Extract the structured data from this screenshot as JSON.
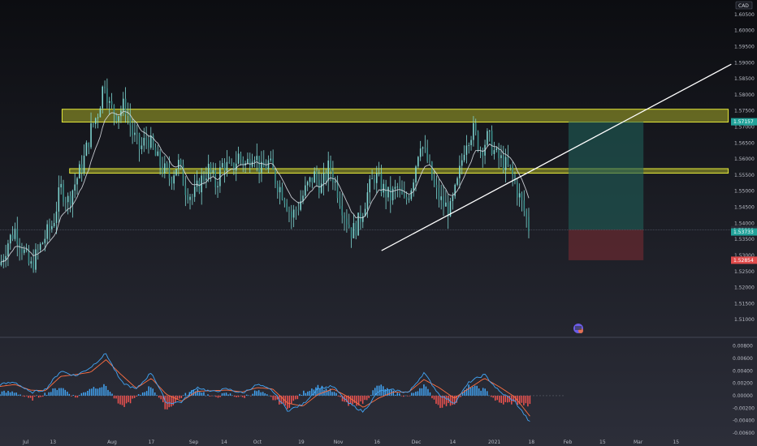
{
  "chart_data": [
    {
      "type": "candlestick",
      "currency": "CAD",
      "ylim": [
        1.5045,
        1.6095
      ],
      "y_ticks": [
        1.51,
        1.515,
        1.52,
        1.525,
        1.53,
        1.535,
        1.54,
        1.545,
        1.55,
        1.555,
        1.56,
        1.565,
        1.57,
        1.575,
        1.58,
        1.585,
        1.59,
        1.595,
        1.6,
        1.605
      ],
      "y_tick_labels": [
        "1.51000",
        "1.51500",
        "1.52000",
        "1.52500",
        "1.53000",
        "1.53500",
        "1.54000",
        "1.54500",
        "1.55000",
        "1.55500",
        "1.56000",
        "1.56500",
        "1.57000",
        "1.57500",
        "1.58000",
        "1.58500",
        "1.59000",
        "1.59500",
        "1.60000",
        "1.60500"
      ],
      "x_ticks": [
        {
          "label": "Jul",
          "x": 0.034
        },
        {
          "label": "13",
          "x": 0.07
        },
        {
          "label": "Aug",
          "x": 0.148
        },
        {
          "label": "17",
          "x": 0.2
        },
        {
          "label": "Sep",
          "x": 0.256
        },
        {
          "label": "14",
          "x": 0.296
        },
        {
          "label": "Oct",
          "x": 0.34
        },
        {
          "label": "19",
          "x": 0.398
        },
        {
          "label": "Nov",
          "x": 0.447
        },
        {
          "label": "16",
          "x": 0.498
        },
        {
          "label": "Dec",
          "x": 0.55
        },
        {
          "label": "14",
          "x": 0.598
        },
        {
          "label": "2021",
          "x": 0.653
        },
        {
          "label": "18",
          "x": 0.702
        },
        {
          "label": "Feb",
          "x": 0.75
        },
        {
          "label": "15",
          "x": 0.796
        },
        {
          "label": "Mar",
          "x": 0.843
        },
        {
          "label": "15",
          "x": 0.893
        }
      ],
      "price_path": [
        [
          0.0,
          1.527
        ],
        [
          0.01,
          1.534
        ],
        [
          0.02,
          1.538
        ],
        [
          0.03,
          1.532
        ],
        [
          0.04,
          1.526
        ],
        [
          0.05,
          1.531
        ],
        [
          0.06,
          1.536
        ],
        [
          0.07,
          1.54
        ],
        [
          0.08,
          1.551
        ],
        [
          0.09,
          1.547
        ],
        [
          0.1,
          1.553
        ],
        [
          0.11,
          1.559
        ],
        [
          0.12,
          1.569
        ],
        [
          0.13,
          1.575
        ],
        [
          0.138,
          1.585
        ],
        [
          0.145,
          1.576
        ],
        [
          0.155,
          1.574
        ],
        [
          0.165,
          1.577
        ],
        [
          0.175,
          1.568
        ],
        [
          0.185,
          1.563
        ],
        [
          0.195,
          1.567
        ],
        [
          0.205,
          1.561
        ],
        [
          0.215,
          1.557
        ],
        [
          0.225,
          1.554
        ],
        [
          0.235,
          1.559
        ],
        [
          0.245,
          1.551
        ],
        [
          0.255,
          1.548
        ],
        [
          0.265,
          1.553
        ],
        [
          0.275,
          1.557
        ],
        [
          0.285,
          1.552
        ],
        [
          0.295,
          1.559
        ],
        [
          0.305,
          1.556
        ],
        [
          0.315,
          1.561
        ],
        [
          0.325,
          1.558
        ],
        [
          0.335,
          1.563
        ],
        [
          0.345,
          1.556
        ],
        [
          0.355,
          1.559
        ],
        [
          0.365,
          1.553
        ],
        [
          0.375,
          1.549
        ],
        [
          0.385,
          1.542
        ],
        [
          0.395,
          1.546
        ],
        [
          0.405,
          1.551
        ],
        [
          0.415,
          1.555
        ],
        [
          0.425,
          1.551
        ],
        [
          0.435,
          1.558
        ],
        [
          0.445,
          1.551
        ],
        [
          0.455,
          1.543
        ],
        [
          0.465,
          1.537
        ],
        [
          0.475,
          1.541
        ],
        [
          0.485,
          1.549
        ],
        [
          0.495,
          1.555
        ],
        [
          0.505,
          1.551
        ],
        [
          0.515,
          1.548
        ],
        [
          0.525,
          1.551
        ],
        [
          0.535,
          1.546
        ],
        [
          0.545,
          1.553
        ],
        [
          0.555,
          1.566
        ],
        [
          0.565,
          1.559
        ],
        [
          0.575,
          1.55
        ],
        [
          0.585,
          1.546
        ],
        [
          0.595,
          1.544
        ],
        [
          0.605,
          1.553
        ],
        [
          0.615,
          1.566
        ],
        [
          0.625,
          1.569
        ],
        [
          0.635,
          1.563
        ],
        [
          0.645,
          1.567
        ],
        [
          0.655,
          1.561
        ],
        [
          0.665,
          1.559
        ],
        [
          0.675,
          1.556
        ],
        [
          0.685,
          1.549
        ],
        [
          0.695,
          1.542
        ],
        [
          0.7,
          1.5373
        ]
      ],
      "annotations": {
        "zones": [
          {
            "y_low": 1.5715,
            "y_high": 1.5755,
            "x0": 0.082,
            "x1": 0.962,
            "color": "#c8cc2c"
          },
          {
            "y_low": 1.5556,
            "y_high": 1.557,
            "x0": 0.092,
            "x1": 0.962,
            "color": "#c8cc2c"
          }
        ],
        "trendline": {
          "from": [
            0.504,
            1.5315
          ],
          "to": [
            0.966,
            1.5895
          ]
        },
        "position": {
          "x0": 0.751,
          "x1": 0.85,
          "entry": 1.538,
          "target": 1.5716,
          "stop": 1.5285
        }
      },
      "price_tags": [
        {
          "label": "1.57157",
          "y": 1.5716,
          "bg": "#22a39a",
          "fg": "#ffffff"
        },
        {
          "label": "1.53800",
          "y": 1.538,
          "bg": "#2a2d38",
          "fg": "#d1d4dc"
        },
        {
          "label": "1.53733",
          "y": 1.5373,
          "bg": "#22a39a",
          "fg": "#ffffff"
        },
        {
          "label": "1.52854",
          "y": 1.5285,
          "bg": "#e04b4b",
          "fg": "#ffffff"
        }
      ],
      "price_tag_extra": {
        "label": "1.5... ",
        "note": "partially hidden"
      }
    },
    {
      "type": "macd",
      "ylim": [
        -0.0068,
        0.0094
      ],
      "y_ticks": [
        0.008,
        0.006,
        0.004,
        0.002,
        0.0,
        -0.002,
        -0.004,
        -0.006
      ],
      "y_tick_labels": [
        "0.00800",
        "0.00600",
        "0.00400",
        "0.00200",
        "0.00000",
        "-0.00200",
        "-0.00400",
        "-0.00600"
      ],
      "macd_path": [
        [
          0.0,
          0.0018
        ],
        [
          0.02,
          0.0022
        ],
        [
          0.04,
          0.0005
        ],
        [
          0.06,
          0.001
        ],
        [
          0.08,
          0.004
        ],
        [
          0.1,
          0.0032
        ],
        [
          0.12,
          0.0046
        ],
        [
          0.14,
          0.0068
        ],
        [
          0.16,
          0.0022
        ],
        [
          0.18,
          0.001
        ],
        [
          0.2,
          0.0038
        ],
        [
          0.22,
          -0.0012
        ],
        [
          0.24,
          -0.001
        ],
        [
          0.26,
          0.0014
        ],
        [
          0.28,
          0.0006
        ],
        [
          0.3,
          0.0011
        ],
        [
          0.32,
          0.0004
        ],
        [
          0.34,
          0.0018
        ],
        [
          0.36,
          0.0008
        ],
        [
          0.38,
          -0.0024
        ],
        [
          0.4,
          -0.0014
        ],
        [
          0.42,
          0.0012
        ],
        [
          0.44,
          0.0015
        ],
        [
          0.46,
          -0.0012
        ],
        [
          0.48,
          -0.0026
        ],
        [
          0.5,
          0.0007
        ],
        [
          0.52,
          0.0009
        ],
        [
          0.54,
          0.0005
        ],
        [
          0.56,
          0.0037
        ],
        [
          0.58,
          0.0002
        ],
        [
          0.6,
          -0.0012
        ],
        [
          0.62,
          0.0022
        ],
        [
          0.64,
          0.0034
        ],
        [
          0.66,
          0.0006
        ],
        [
          0.68,
          -0.0009
        ],
        [
          0.7,
          -0.0043
        ]
      ],
      "signal_path": [
        [
          0.0,
          0.0015
        ],
        [
          0.02,
          0.0018
        ],
        [
          0.04,
          0.0009
        ],
        [
          0.06,
          0.0008
        ],
        [
          0.08,
          0.0031
        ],
        [
          0.1,
          0.0034
        ],
        [
          0.12,
          0.0038
        ],
        [
          0.14,
          0.0058
        ],
        [
          0.16,
          0.0034
        ],
        [
          0.18,
          0.0012
        ],
        [
          0.2,
          0.0028
        ],
        [
          0.22,
          0.0002
        ],
        [
          0.24,
          -0.0009
        ],
        [
          0.26,
          0.0007
        ],
        [
          0.28,
          0.0008
        ],
        [
          0.3,
          0.0009
        ],
        [
          0.32,
          0.0006
        ],
        [
          0.34,
          0.0013
        ],
        [
          0.36,
          0.0011
        ],
        [
          0.38,
          -0.0012
        ],
        [
          0.4,
          -0.0017
        ],
        [
          0.42,
          0.0002
        ],
        [
          0.44,
          0.0011
        ],
        [
          0.46,
          -0.0002
        ],
        [
          0.48,
          -0.0019
        ],
        [
          0.5,
          -0.0004
        ],
        [
          0.52,
          0.0006
        ],
        [
          0.54,
          0.0006
        ],
        [
          0.56,
          0.0026
        ],
        [
          0.58,
          0.0013
        ],
        [
          0.6,
          -0.0004
        ],
        [
          0.62,
          0.0012
        ],
        [
          0.64,
          0.0028
        ],
        [
          0.66,
          0.0014
        ],
        [
          0.68,
          -0.0002
        ],
        [
          0.7,
          -0.0033
        ]
      ],
      "colors": {
        "macd": "#42a5f5",
        "signal": "#ff7043",
        "hist_pos": "#42a5f5",
        "hist_neg": "#ef5350"
      }
    }
  ],
  "colors": {
    "background_top": "#0d0e12",
    "background_bottom": "#2b2d38",
    "candle": "#7fd6d2",
    "ema": "#d8dbe2",
    "zone_stroke": "#e6ea3a",
    "target_fill": "#1f5f59",
    "stop_fill": "#6a2a30",
    "axis_text": "#b7bac3",
    "divider": "#3a3d48"
  }
}
